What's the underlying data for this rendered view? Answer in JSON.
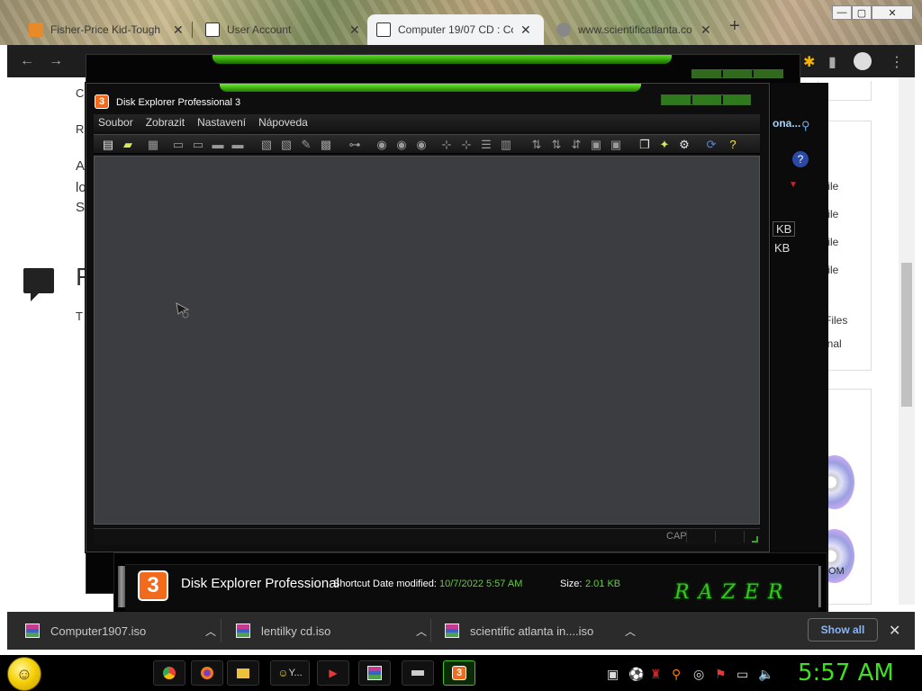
{
  "browser": {
    "tabs": [
      {
        "label": "Fisher-Price Kid-Tough",
        "close": "✕",
        "active": false
      },
      {
        "label": "User Account",
        "close": "✕",
        "active": false
      },
      {
        "label": "Computer 19/07 CD : Co",
        "close": "✕",
        "active": true
      },
      {
        "label": "www.scientificatlanta.co",
        "close": "✕",
        "active": false
      }
    ],
    "new_tab": "+",
    "window_buttons": {
      "minimize": "—",
      "maximize": "▢",
      "close": "✕"
    }
  },
  "webpage": {
    "fragments": {
      "c": "C",
      "r": "R",
      "a": "A",
      "l": "lo",
      "s": "S",
      "big_r": "R",
      "t": "T"
    },
    "files": [
      "file",
      "file",
      "file",
      "file"
    ],
    "sizes": [
      "KB",
      "KB"
    ],
    "files_label": "Files",
    "inal_label": "inal",
    "om_label": "OM"
  },
  "disk_explorer": {
    "title": "Disk Explorer Professional 3",
    "logo_char": "3",
    "menu": [
      "Soubor",
      "Zobrazit",
      "Nastavení",
      "Nápoveda"
    ],
    "search_hint": "ona...",
    "help_icon": "?",
    "statusbar": {
      "cap": "CAP"
    }
  },
  "info_panel": {
    "name": "Disk Explorer Professional",
    "meta_prefix": "Shortcut Date modified:",
    "date": "10/7/2022 5:57 AM",
    "size_label": "Size:",
    "size": "2.01 KB",
    "brand": "RAZER"
  },
  "downloads": {
    "items": [
      "Computer1907.iso",
      "lentilky cd.iso",
      "scientific atlanta in....iso"
    ],
    "show_all": "Show all",
    "close": "✕"
  },
  "taskbar": {
    "y_label": "Y...",
    "clock": "5:57 AM"
  },
  "colors": {
    "accent_green": "#40e020",
    "razer_green": "#32c81e",
    "logo_orange": "#f26b1d"
  }
}
